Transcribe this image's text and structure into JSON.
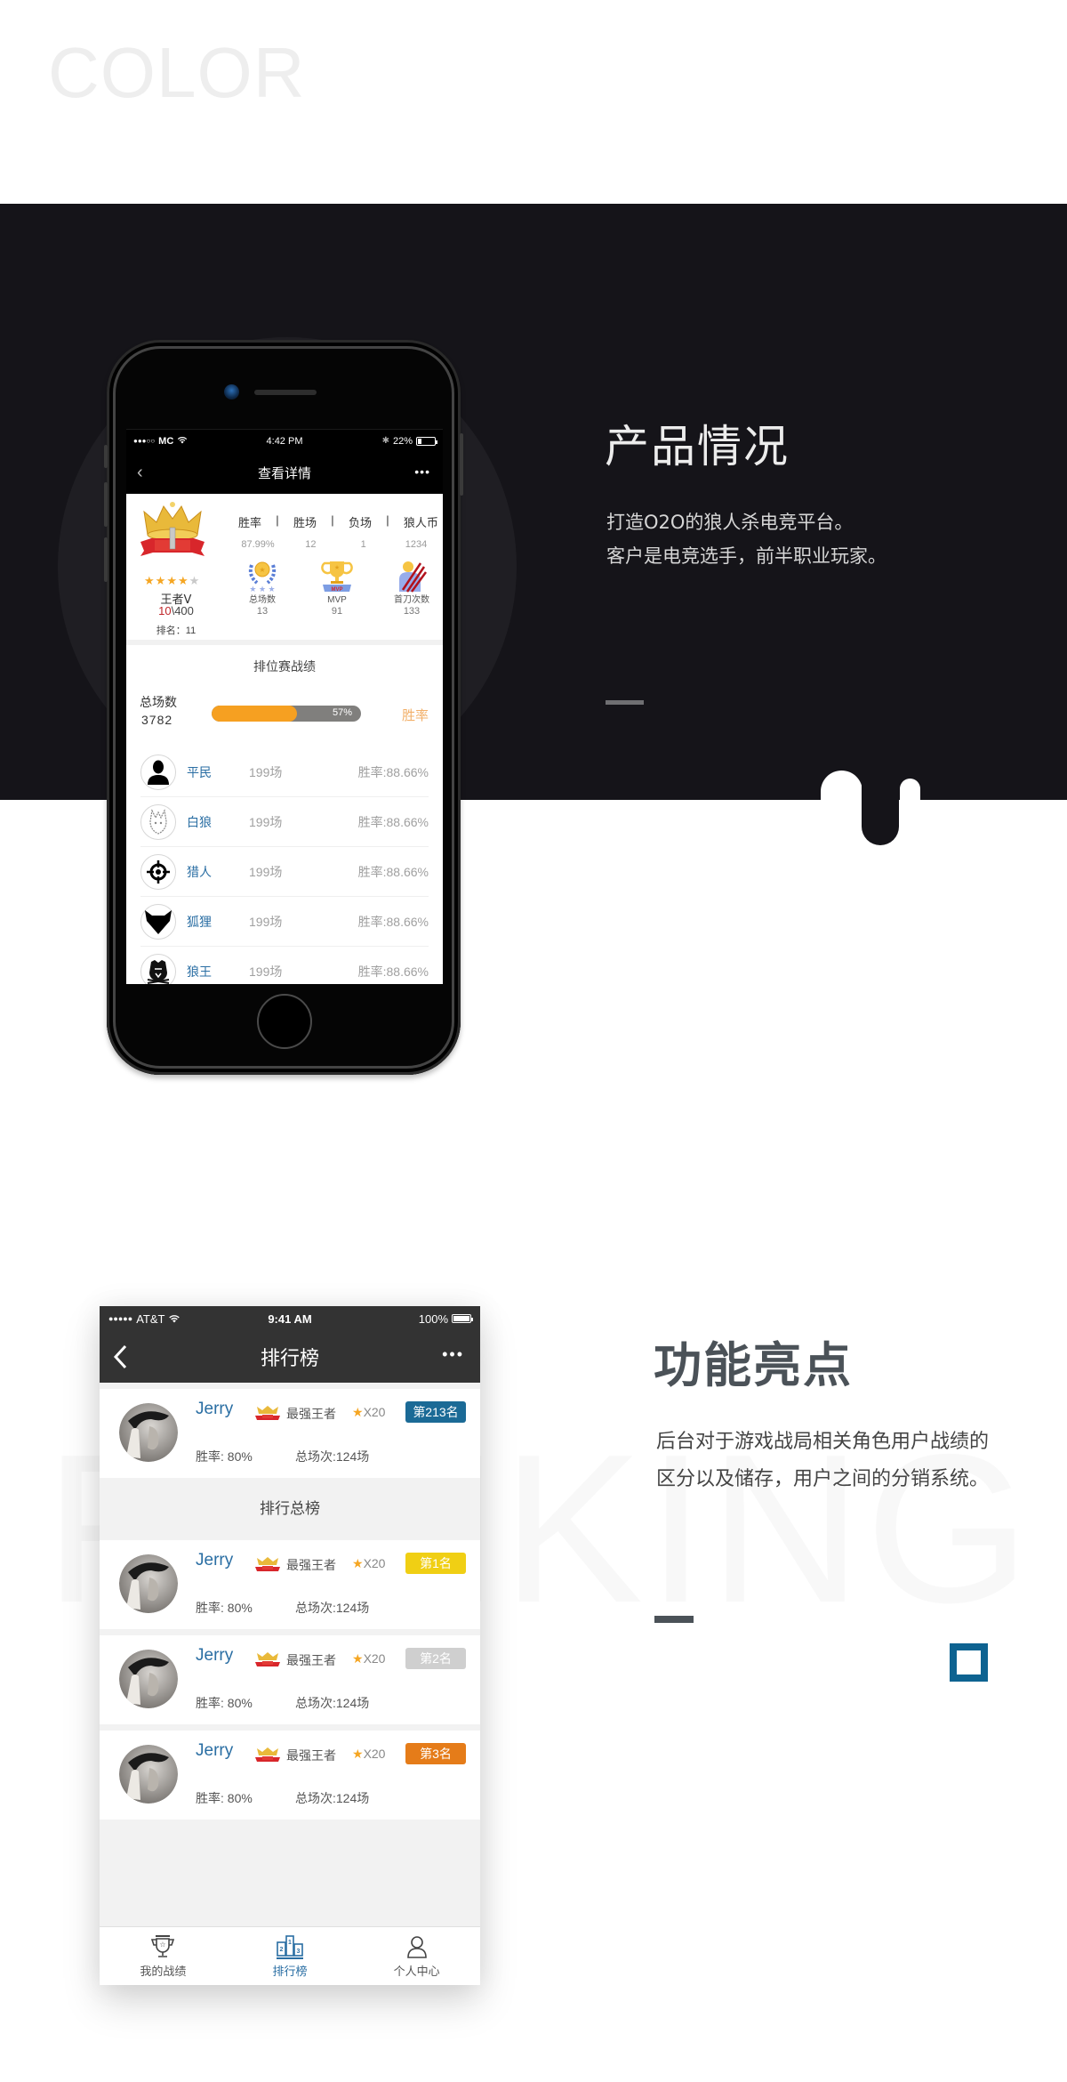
{
  "header": {
    "watermark": "COLOR"
  },
  "section1": {
    "title": "产品情况",
    "desc_lines": [
      "打造O2O的狼人杀电竞平台。",
      "客户是电竞选手，前半职业玩家。"
    ]
  },
  "phone1": {
    "status": {
      "signal": "●●●○○",
      "carrier": "MC",
      "time": "4:42 PM",
      "bluetooth": "✱",
      "battery": "22%",
      "battery_level": 0.22
    },
    "nav": {
      "back": "‹",
      "title": "查看详情",
      "more": "•••"
    },
    "profile": {
      "stars_on": 4,
      "stars_total": 5,
      "rank_title": "王者Ⅴ",
      "progress_current": "10",
      "progress_rest": "\\400",
      "rank_no": "排名：11",
      "stat_headers": [
        "胜率",
        "胜场",
        "负场",
        "狼人币"
      ],
      "stat_sep": "|",
      "stat_values": [
        "87.99%",
        "12",
        "1",
        "1234"
      ],
      "badges": [
        {
          "label": "总场数",
          "value": "13",
          "icon": "laurel-medal-icon"
        },
        {
          "label": "MVP",
          "value": "91",
          "icon": "trophy-mvp-icon"
        },
        {
          "label": "首刀次数",
          "value": "133",
          "icon": "claw-slash-icon"
        }
      ]
    },
    "ranked": {
      "title": "排位赛战绩",
      "total_label": "总场数",
      "total_value": "3782",
      "win_rate_percent": 57,
      "win_rate_text": "57%",
      "win_rate_label": "胜率"
    },
    "roles": [
      {
        "name": "平民",
        "games": "199场",
        "rate": "胜率:88.66%",
        "icon": "villager-icon"
      },
      {
        "name": "白狼",
        "games": "199场",
        "rate": "胜率:88.66%",
        "icon": "white-wolf-icon"
      },
      {
        "name": "猎人",
        "games": "199场",
        "rate": "胜率:88.66%",
        "icon": "hunter-crosshair-icon"
      },
      {
        "name": "狐狸",
        "games": "199场",
        "rate": "胜率:88.66%",
        "icon": "fox-icon"
      },
      {
        "name": "狼王",
        "games": "199场",
        "rate": "胜率:88.66%",
        "icon": "wolf-king-icon"
      }
    ]
  },
  "section2": {
    "watermark": "RANKING",
    "title": "功能亮点",
    "desc_lines": [
      "后台对于游戏战局相关角色用户战绩的",
      "区分以及储存，用户之间的分销系统。"
    ],
    "accent_color": "#0e6391"
  },
  "phone2": {
    "status": {
      "signal": "●●●●●",
      "carrier": "AT&T",
      "time": "9:41 AM",
      "battery": "100%",
      "battery_level": 1.0
    },
    "nav": {
      "title": "排行榜",
      "more": "•••"
    },
    "my_rank": {
      "name": "Jerry",
      "title": "最强王者",
      "stars": "X20",
      "position": "第213名",
      "rate": "胜率: 80%",
      "games": "总场次:124场",
      "badge_color": "#1b6a96"
    },
    "section_title": "排行总榜",
    "leaders": [
      {
        "name": "Jerry",
        "title": "最强王者",
        "stars": "X20",
        "position": "第1名",
        "rate": "胜率: 80%",
        "games": "总场次:124场",
        "badge_color": "#f0cf14"
      },
      {
        "name": "Jerry",
        "title": "最强王者",
        "stars": "X20",
        "position": "第2名",
        "rate": "胜率: 80%",
        "games": "总场次:124场",
        "badge_color": "#cfcfcf"
      },
      {
        "name": "Jerry",
        "title": "最强王者",
        "stars": "X20",
        "position": "第3名",
        "rate": "胜率: 80%",
        "games": "总场次:124场",
        "badge_color": "#e57c19"
      }
    ],
    "tabs": [
      {
        "label": "我的战绩",
        "icon": "trophy-icon",
        "active": false
      },
      {
        "label": "排行榜",
        "icon": "podium-icon",
        "active": true
      },
      {
        "label": "个人中心",
        "icon": "user-icon",
        "active": false
      }
    ]
  }
}
